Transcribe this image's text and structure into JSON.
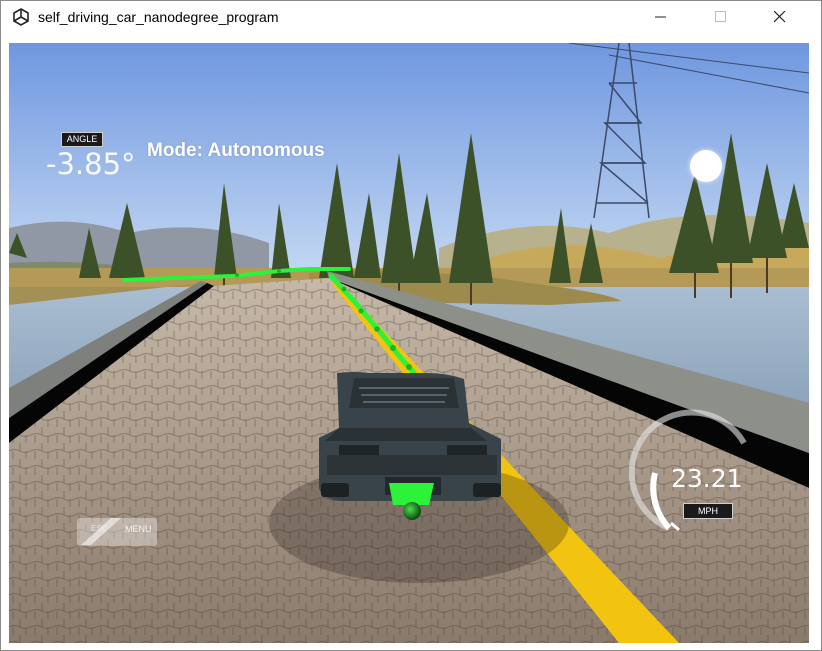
{
  "window": {
    "title": "self_driving_car_nanodegree_program"
  },
  "hud": {
    "angle_label": "ANGLE",
    "angle_value": "-3.85°",
    "mode_text": "Mode: Autonomous",
    "speed_value": "23.21",
    "speed_unit": "MPH",
    "menu_key": "ESC",
    "menu_label": "MENU"
  },
  "colors": {
    "sky": "#8fb6e8",
    "road": "#9b8b7c",
    "lane_line": "#f2c40f",
    "trajectory": "#2cf23a",
    "water": "#8ea7c0",
    "car": "#3a4449"
  },
  "icons": {
    "app": "unity-logo-icon",
    "minimize": "minimize-icon",
    "maximize": "maximize-icon",
    "close": "close-icon",
    "record": "record-icon",
    "speedometer": "speedometer-gauge-icon"
  }
}
